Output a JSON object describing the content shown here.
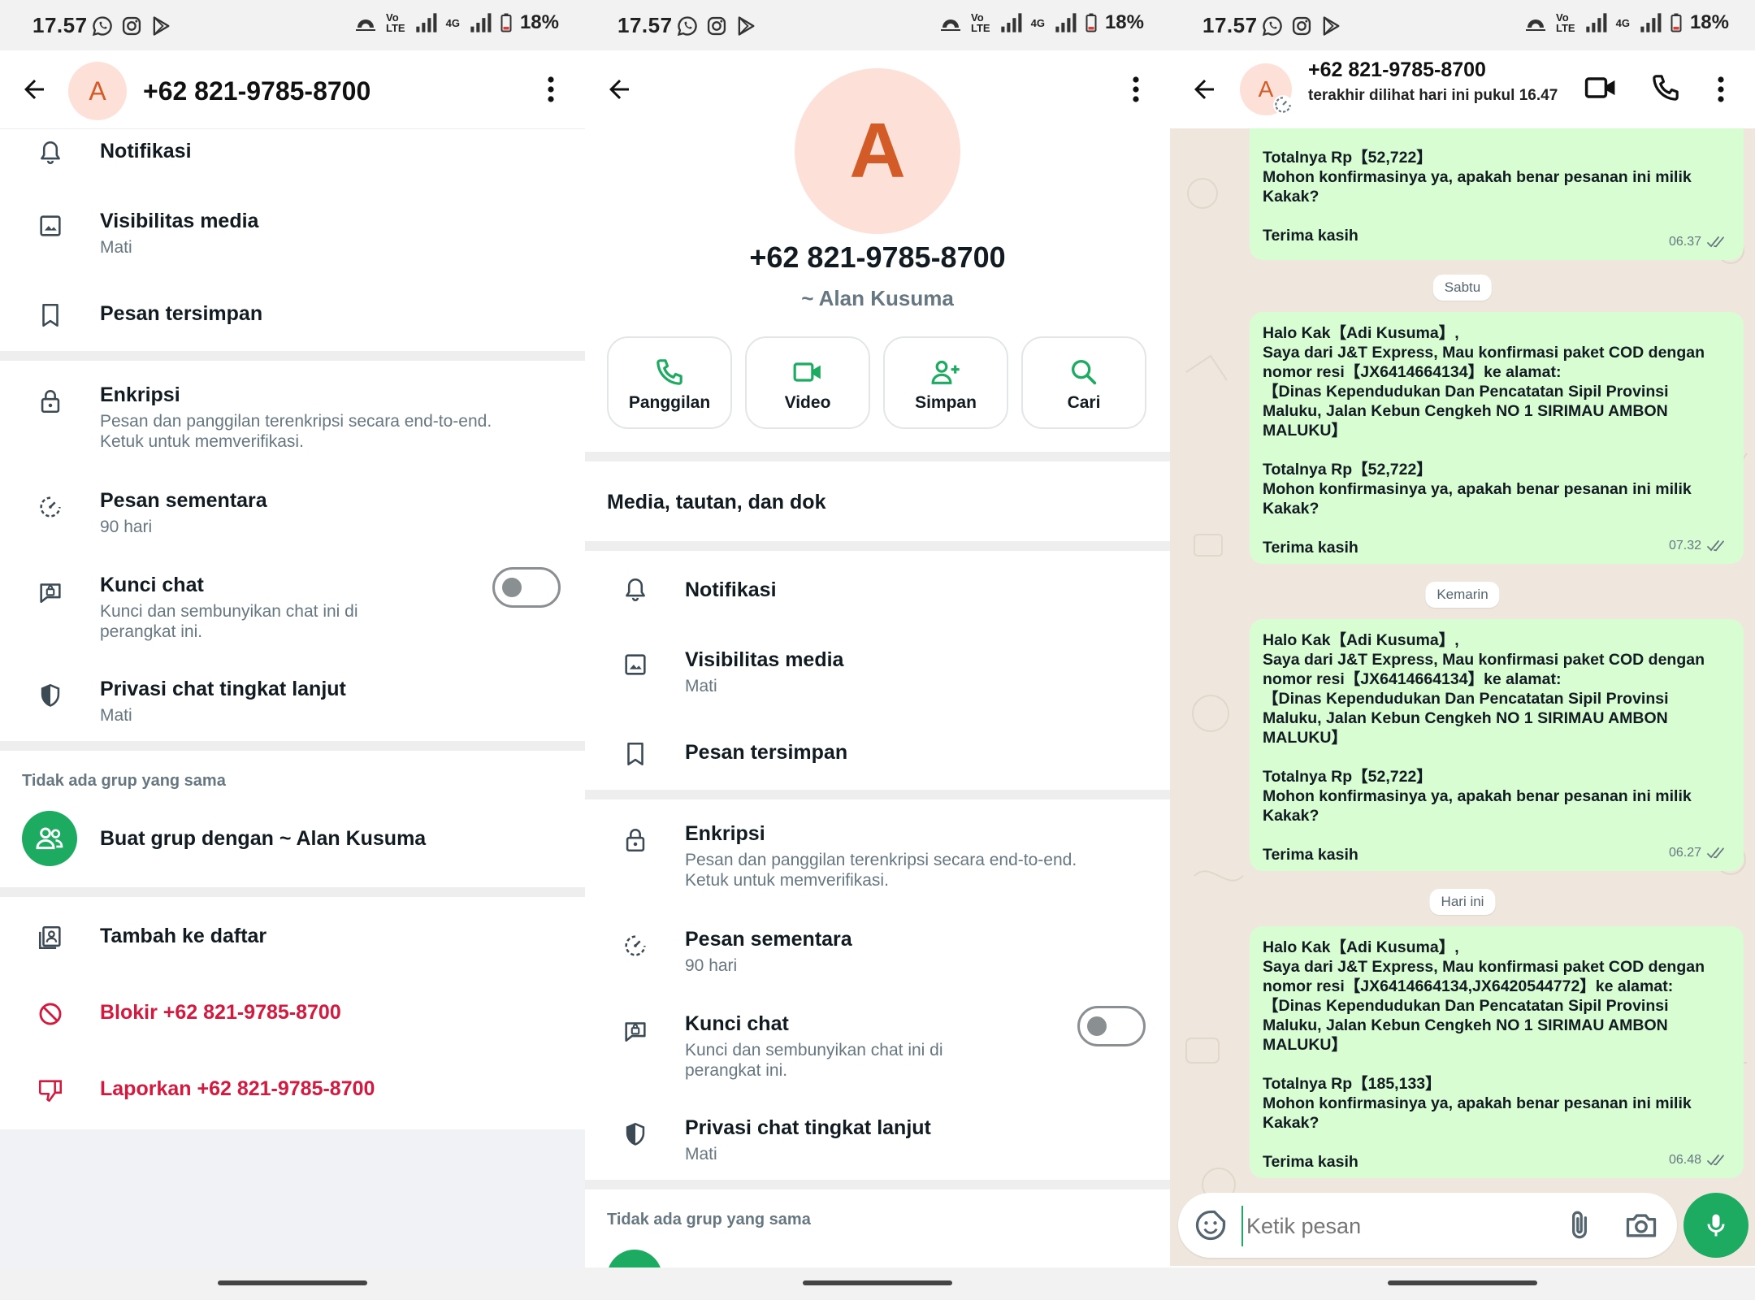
{
  "status_bar": {
    "time": "17.57",
    "battery": "18%",
    "signal_label_1": "Vo\nLTE",
    "signal_label_2": "4G"
  },
  "contact": {
    "number": "+62 821-9785-8700",
    "name": "~ Alan Kusuma",
    "avatar_letter": "A"
  },
  "screen1": {
    "notifications": "Notifikasi",
    "media_visibility": {
      "title": "Visibilitas media",
      "value": "Mati"
    },
    "saved_messages": "Pesan tersimpan",
    "encryption": {
      "title": "Enkripsi",
      "desc": "Pesan dan panggilan terenkripsi secara end-to-end.\nKetuk untuk memverifikasi."
    },
    "disappearing": {
      "title": "Pesan sementara",
      "value": "90 hari"
    },
    "chat_lock": {
      "title": "Kunci chat",
      "desc": "Kunci dan sembunyikan chat ini di\nperangkat ini."
    },
    "advanced_privacy": {
      "title": "Privasi chat tingkat lanjut",
      "value": "Mati"
    },
    "no_groups_label": "Tidak ada grup yang sama",
    "create_group": "Buat grup dengan ~ Alan Kusuma",
    "add_to_list": "Tambah ke daftar",
    "block": "Blokir +62 821-9785-8700",
    "report": "Laporkan +62 821-9785-8700"
  },
  "screen2": {
    "actions": {
      "call": "Panggilan",
      "video": "Video",
      "save": "Simpan",
      "search": "Cari"
    },
    "media_links_docs": "Media, tautan, dan dok",
    "notifications": "Notifikasi",
    "media_visibility": {
      "title": "Visibilitas media",
      "value": "Mati"
    },
    "saved_messages": "Pesan tersimpan",
    "encryption": {
      "title": "Enkripsi",
      "desc": "Pesan dan panggilan terenkripsi secara end-to-end.\nKetuk untuk memverifikasi."
    },
    "disappearing": {
      "title": "Pesan sementara",
      "value": "90 hari"
    },
    "chat_lock": {
      "title": "Kunci chat",
      "desc": "Kunci dan sembunyikan chat ini di\nperangkat ini."
    },
    "advanced_privacy": {
      "title": "Privasi chat tingkat lanjut",
      "value": "Mati"
    },
    "no_groups_label": "Tidak ada grup yang sama"
  },
  "screen3": {
    "last_seen": "terakhir dilihat hari ini pukul 16.47",
    "messages": [
      {
        "text": "Totalnya Rp【52,722】\nMohon konfirmasinya ya, apakah benar pesanan ini milik Kakak?\n\nTerima kasih",
        "time": "06.37"
      },
      {
        "date": "Sabtu"
      },
      {
        "text": "Halo Kak【Adi Kusuma】,\nSaya dari J&T Express, Mau konfirmasi paket COD dengan nomor resi【JX6414664134】ke alamat:\n【Dinas Kependudukan Dan Pencatatan Sipil Provinsi Maluku, Jalan Kebun Cengkeh NO 1  SIRIMAU AMBON MALUKU】\n\nTotalnya Rp【52,722】\nMohon konfirmasinya ya, apakah benar pesanan ini milik Kakak?\n\nTerima kasih",
        "time": "07.32"
      },
      {
        "date": "Kemarin"
      },
      {
        "text": "Halo Kak【Adi Kusuma】,\nSaya dari J&T Express, Mau konfirmasi paket COD dengan nomor resi【JX6414664134】ke alamat:\n【Dinas Kependudukan Dan Pencatatan Sipil Provinsi Maluku, Jalan Kebun Cengkeh NO 1  SIRIMAU AMBON MALUKU】\n\nTotalnya Rp【52,722】\nMohon konfirmasinya ya, apakah benar pesanan ini milik Kakak?\n\nTerima kasih",
        "time": "06.27"
      },
      {
        "date": "Hari ini"
      },
      {
        "text": "Halo Kak【Adi Kusuma】,\nSaya dari J&T Express, Mau konfirmasi paket COD dengan nomor resi【JX6414664134,JX6420544772】ke alamat:\n【Dinas Kependudukan Dan Pencatatan Sipil Provinsi Maluku, Jalan Kebun Cengkeh NO 1  SIRIMAU AMBON MALUKU】\n\nTotalnya Rp【185,133】\nMohon konfirmasinya ya, apakah benar pesanan ini milik Kakak?\n\nTerima kasih",
        "time": "06.48"
      }
    ],
    "composer_placeholder": "Ketik pesan"
  },
  "icons": {
    "back": "arrow-left-icon",
    "menu": "more-vertical-icon",
    "bell": "bell-icon",
    "image": "image-icon",
    "bookmark": "bookmark-icon",
    "lock": "lock-icon",
    "timer": "timer-icon",
    "chat_lock": "chat-lock-icon",
    "shield": "shield-icon",
    "group": "group-icon",
    "list": "contact-list-icon",
    "block": "block-icon",
    "thumb_down": "thumb-down-icon",
    "phone": "phone-icon",
    "video": "video-icon",
    "add_person": "add-person-icon",
    "search": "search-icon",
    "emoji": "emoji-icon",
    "attach": "paperclip-icon",
    "camera": "camera-icon",
    "mic": "mic-icon"
  },
  "colors": {
    "accent_green": "#1daa61",
    "danger_red": "#d4193f",
    "bubble_green": "#d9fdd3",
    "avatar_bg": "#fde1d8",
    "avatar_fg": "#d35b28"
  }
}
